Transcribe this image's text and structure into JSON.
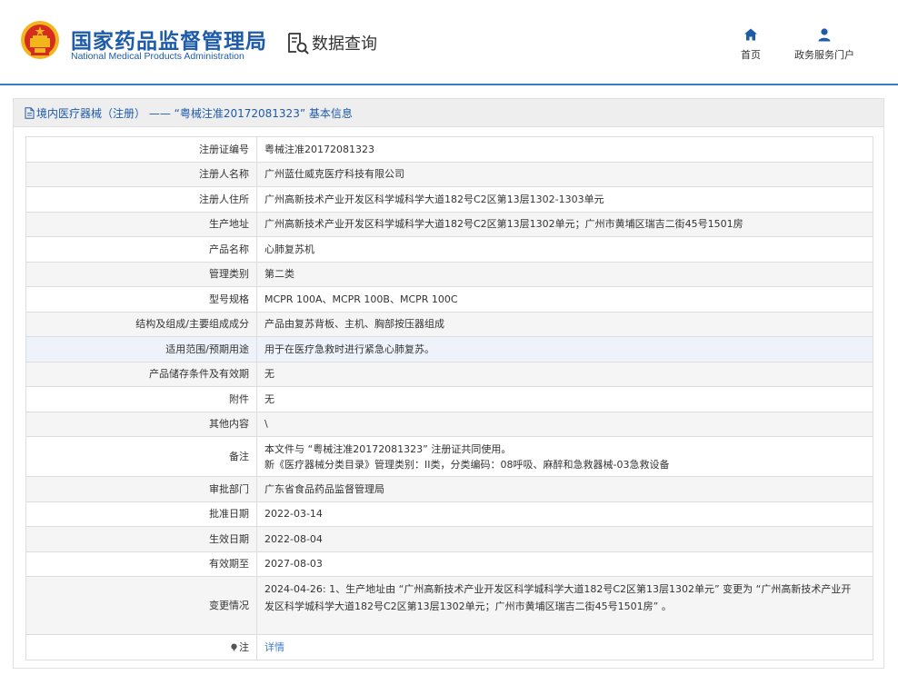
{
  "header": {
    "org_name_cn": "国家药品监督管理局",
    "org_name_en": "National Medical Products Administration",
    "section_label": "数据查询",
    "nav": {
      "home": "首页",
      "portal": "政务服务门户"
    }
  },
  "panel": {
    "title": "境内医疗器械（注册） —— “粤械注准20172081323” 基本信息"
  },
  "rows": [
    {
      "label": "注册证编号",
      "value": "粤械注准20172081323"
    },
    {
      "label": "注册人名称",
      "value": "广州蓝仕威克医疗科技有限公司"
    },
    {
      "label": "注册人住所",
      "value": "广州高新技术产业开发区科学城科学大道182号C2区第13层1302-1303单元"
    },
    {
      "label": "生产地址",
      "value": "广州高新技术产业开发区科学城科学大道182号C2区第13层1302单元；广州市黄埔区瑞吉二街45号1501房"
    },
    {
      "label": "产品名称",
      "value": "心肺复苏机"
    },
    {
      "label": "管理类别",
      "value": "第二类"
    },
    {
      "label": "型号规格",
      "value": "MCPR 100A、MCPR 100B、MCPR 100C"
    },
    {
      "label": "结构及组成/主要组成成分",
      "value": "产品由复苏背板、主机、胸部按压器组成"
    },
    {
      "label": "适用范围/预期用途",
      "value": "用于在医疗急救时进行紧急心肺复苏。"
    },
    {
      "label": "产品储存条件及有效期",
      "value": "无"
    },
    {
      "label": "附件",
      "value": "无"
    },
    {
      "label": "其他内容",
      "value": "\\"
    },
    {
      "label": "备注",
      "value_line1": "本文件与 “粤械注准20172081323” 注册证共同使用。",
      "value_line2": "新《医疗器械分类目录》管理类别：II类，分类编码：08呼吸、麻醉和急救器械-03急救设备"
    },
    {
      "label": "审批部门",
      "value": "广东省食品药品监督管理局"
    },
    {
      "label": "批准日期",
      "value": "2022-03-14"
    },
    {
      "label": "生效日期",
      "value": "2022-08-04"
    },
    {
      "label": "有效期至",
      "value": "2027-08-03"
    },
    {
      "label": "变更情况",
      "value_line1": "2024-04-26: 1、生产地址由 “广州高新技术产业开发区科学城科学大道182号C2区第13层1302单元” 变更为 “广州高新技术产业开",
      "value_line2": "发区科学城科学大道182号C2区第13层1302单元；广州市黄埔区瑞吉二街45号1501房” 。"
    },
    {
      "label": "注",
      "value": "详情"
    }
  ],
  "colors": {
    "brand_blue": "#1e5ba8",
    "link_blue": "#3d7ecb",
    "emblem_red": "#d62b1f",
    "emblem_gold": "#f2b51c"
  },
  "icons": {
    "emblem": "national-emblem-icon",
    "data_query": "document-search-icon",
    "home": "home-icon",
    "portal": "user-icon",
    "doc": "document-icon",
    "note": "pin-icon"
  }
}
